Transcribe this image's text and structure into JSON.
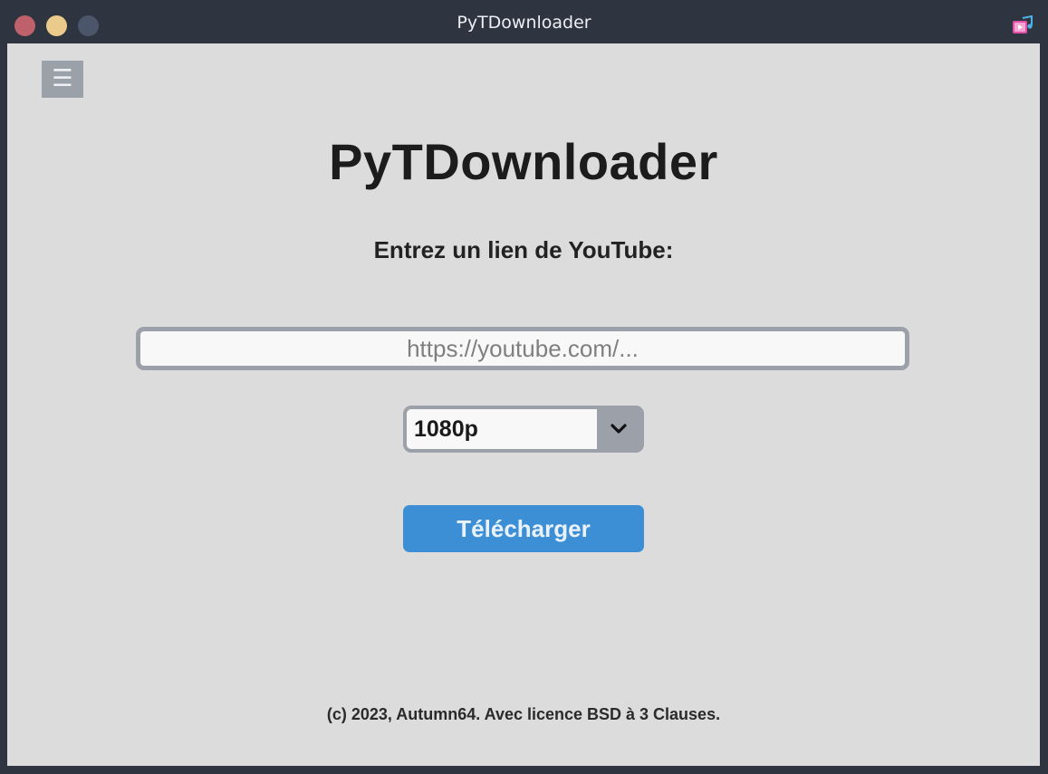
{
  "window": {
    "title": "PyTDownloader",
    "controls": [
      "close",
      "minimize",
      "maximize"
    ],
    "app_icon": "video-music-icon"
  },
  "menu": {
    "icon": "hamburger-menu-icon",
    "glyph": "☰"
  },
  "main": {
    "heading": "PyTDownloader",
    "prompt": "Entrez un lien de YouTube:",
    "url_input": {
      "value": "",
      "placeholder": "https://youtube.com/..."
    },
    "quality_select": {
      "selected": "1080p",
      "icon": "chevron-down-icon"
    },
    "download_button": "Télécharger"
  },
  "footer": "(c) 2023, Autumn64. Avec licence BSD à 3 Clauses.",
  "colors": {
    "titlebar_bg": "#2e3440",
    "content_bg": "#dcdcdc",
    "accent_button": "#3c8fd5",
    "close": "#bf616a",
    "minimize": "#ebcb8b",
    "maximize": "#4c566a"
  }
}
